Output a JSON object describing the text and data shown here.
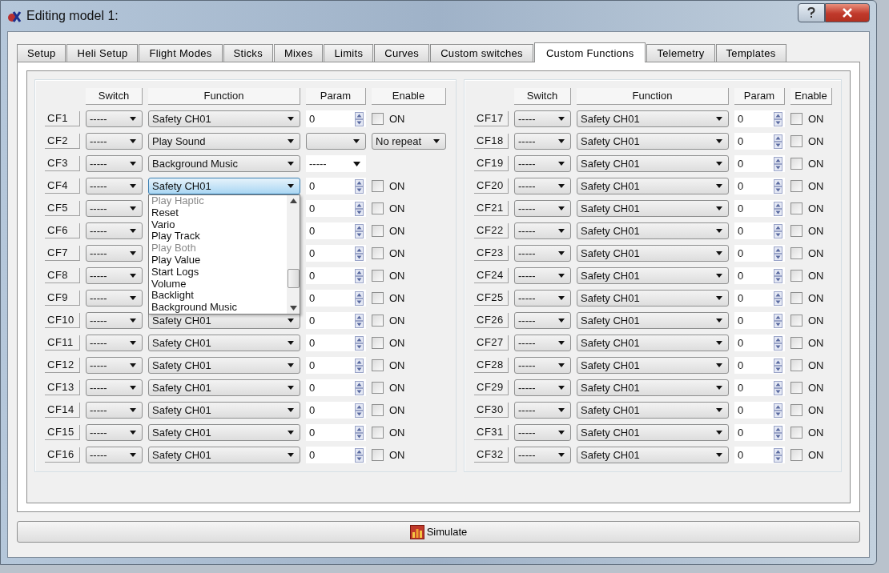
{
  "window": {
    "title": "Editing model 1:"
  },
  "tabs": [
    {
      "label": "Setup",
      "selected": false
    },
    {
      "label": "Heli Setup",
      "selected": false
    },
    {
      "label": "Flight Modes",
      "selected": false
    },
    {
      "label": "Sticks",
      "selected": false
    },
    {
      "label": "Mixes",
      "selected": false
    },
    {
      "label": "Limits",
      "selected": false
    },
    {
      "label": "Curves",
      "selected": false
    },
    {
      "label": "Custom switches",
      "selected": false
    },
    {
      "label": "Custom Functions",
      "selected": true
    },
    {
      "label": "Telemetry",
      "selected": false
    },
    {
      "label": "Templates",
      "selected": false
    }
  ],
  "groups": [
    {
      "headers": [
        "Switch",
        "Function",
        "Param",
        "Enable"
      ],
      "rows": [
        {
          "label": "CF1",
          "switch": "-----",
          "function": {
            "value": "Safety CH01",
            "focused": false
          },
          "param": {
            "kind": "spin",
            "value": "0"
          },
          "enable": {
            "kind": "checkbox",
            "checked": false,
            "label": "ON"
          }
        },
        {
          "label": "CF2",
          "switch": "-----",
          "function": {
            "value": "Play Sound",
            "focused": false
          },
          "param": {
            "kind": "select"
          },
          "enable": {
            "kind": "select",
            "value": "No repeat"
          }
        },
        {
          "label": "CF3",
          "switch": "-----",
          "function": {
            "value": "Background Music",
            "focused": false
          },
          "param": {
            "kind": "plain-select",
            "value": "-----"
          }
        },
        {
          "label": "CF4",
          "switch": "-----",
          "function": {
            "value": "Safety CH01",
            "focused": true,
            "options": [
              {
                "label": "Play Haptic",
                "disabled": true
              },
              {
                "label": "Reset",
                "disabled": false
              },
              {
                "label": "Vario",
                "disabled": false
              },
              {
                "label": "Play Track",
                "disabled": false
              },
              {
                "label": "Play Both",
                "disabled": true
              },
              {
                "label": "Play Value",
                "disabled": false
              },
              {
                "label": "Start Logs",
                "disabled": false
              },
              {
                "label": "Volume",
                "disabled": false
              },
              {
                "label": "Backlight",
                "disabled": false
              },
              {
                "label": "Background Music",
                "disabled": false
              }
            ]
          },
          "param": {
            "kind": "spin",
            "value": "0"
          },
          "enable": {
            "kind": "checkbox",
            "checked": false,
            "label": "ON"
          }
        },
        {
          "label": "CF5",
          "switch": "-----",
          "param": {
            "kind": "spin",
            "value": "0"
          },
          "enable": {
            "kind": "checkbox",
            "checked": false,
            "label": "ON"
          }
        },
        {
          "label": "CF6",
          "switch": "-----",
          "param": {
            "kind": "spin",
            "value": "0"
          },
          "enable": {
            "kind": "checkbox",
            "checked": false,
            "label": "ON"
          }
        },
        {
          "label": "CF7",
          "switch": "-----",
          "param": {
            "kind": "spin",
            "value": "0"
          },
          "enable": {
            "kind": "checkbox",
            "checked": false,
            "label": "ON"
          }
        },
        {
          "label": "CF8",
          "switch": "-----",
          "param": {
            "kind": "spin",
            "value": "0"
          },
          "enable": {
            "kind": "checkbox",
            "checked": false,
            "label": "ON"
          }
        },
        {
          "label": "CF9",
          "switch": "-----",
          "param": {
            "kind": "spin",
            "value": "0"
          },
          "enable": {
            "kind": "checkbox",
            "checked": false,
            "label": "ON"
          }
        },
        {
          "label": "CF10",
          "switch": "-----",
          "function": {
            "value": "Safety CH01",
            "focused": false
          },
          "param": {
            "kind": "spin",
            "value": "0"
          },
          "enable": {
            "kind": "checkbox",
            "checked": false,
            "label": "ON"
          }
        },
        {
          "label": "CF11",
          "switch": "-----",
          "function": {
            "value": "Safety CH01",
            "focused": false
          },
          "param": {
            "kind": "spin",
            "value": "0"
          },
          "enable": {
            "kind": "checkbox",
            "checked": false,
            "label": "ON"
          }
        },
        {
          "label": "CF12",
          "switch": "-----",
          "function": {
            "value": "Safety CH01",
            "focused": false
          },
          "param": {
            "kind": "spin",
            "value": "0"
          },
          "enable": {
            "kind": "checkbox",
            "checked": false,
            "label": "ON"
          }
        },
        {
          "label": "CF13",
          "switch": "-----",
          "function": {
            "value": "Safety CH01",
            "focused": false
          },
          "param": {
            "kind": "spin",
            "value": "0"
          },
          "enable": {
            "kind": "checkbox",
            "checked": false,
            "label": "ON"
          }
        },
        {
          "label": "CF14",
          "switch": "-----",
          "function": {
            "value": "Safety CH01",
            "focused": false
          },
          "param": {
            "kind": "spin",
            "value": "0"
          },
          "enable": {
            "kind": "checkbox",
            "checked": false,
            "label": "ON"
          }
        },
        {
          "label": "CF15",
          "switch": "-----",
          "function": {
            "value": "Safety CH01",
            "focused": false
          },
          "param": {
            "kind": "spin",
            "value": "0"
          },
          "enable": {
            "kind": "checkbox",
            "checked": false,
            "label": "ON"
          }
        },
        {
          "label": "CF16",
          "switch": "-----",
          "function": {
            "value": "Safety CH01",
            "focused": false
          },
          "param": {
            "kind": "spin",
            "value": "0"
          },
          "enable": {
            "kind": "checkbox",
            "checked": false,
            "label": "ON"
          }
        }
      ]
    },
    {
      "headers": [
        "Switch",
        "Function",
        "Param",
        "Enable"
      ],
      "rows": [
        {
          "label": "CF17",
          "switch": "-----",
          "function": {
            "value": "Safety CH01",
            "focused": false
          },
          "param": {
            "kind": "spin",
            "value": "0"
          },
          "enable": {
            "kind": "checkbox",
            "checked": false,
            "label": "ON"
          }
        },
        {
          "label": "CF18",
          "switch": "-----",
          "function": {
            "value": "Safety CH01",
            "focused": false
          },
          "param": {
            "kind": "spin",
            "value": "0"
          },
          "enable": {
            "kind": "checkbox",
            "checked": false,
            "label": "ON"
          }
        },
        {
          "label": "CF19",
          "switch": "-----",
          "function": {
            "value": "Safety CH01",
            "focused": false
          },
          "param": {
            "kind": "spin",
            "value": "0"
          },
          "enable": {
            "kind": "checkbox",
            "checked": false,
            "label": "ON"
          }
        },
        {
          "label": "CF20",
          "switch": "-----",
          "function": {
            "value": "Safety CH01",
            "focused": false
          },
          "param": {
            "kind": "spin",
            "value": "0"
          },
          "enable": {
            "kind": "checkbox",
            "checked": false,
            "label": "ON"
          }
        },
        {
          "label": "CF21",
          "switch": "-----",
          "function": {
            "value": "Safety CH01",
            "focused": false
          },
          "param": {
            "kind": "spin",
            "value": "0"
          },
          "enable": {
            "kind": "checkbox",
            "checked": false,
            "label": "ON"
          }
        },
        {
          "label": "CF22",
          "switch": "-----",
          "function": {
            "value": "Safety CH01",
            "focused": false
          },
          "param": {
            "kind": "spin",
            "value": "0"
          },
          "enable": {
            "kind": "checkbox",
            "checked": false,
            "label": "ON"
          }
        },
        {
          "label": "CF23",
          "switch": "-----",
          "function": {
            "value": "Safety CH01",
            "focused": false
          },
          "param": {
            "kind": "spin",
            "value": "0"
          },
          "enable": {
            "kind": "checkbox",
            "checked": false,
            "label": "ON"
          }
        },
        {
          "label": "CF24",
          "switch": "-----",
          "function": {
            "value": "Safety CH01",
            "focused": false
          },
          "param": {
            "kind": "spin",
            "value": "0"
          },
          "enable": {
            "kind": "checkbox",
            "checked": false,
            "label": "ON"
          }
        },
        {
          "label": "CF25",
          "switch": "-----",
          "function": {
            "value": "Safety CH01",
            "focused": false
          },
          "param": {
            "kind": "spin",
            "value": "0"
          },
          "enable": {
            "kind": "checkbox",
            "checked": false,
            "label": "ON"
          }
        },
        {
          "label": "CF26",
          "switch": "-----",
          "function": {
            "value": "Safety CH01",
            "focused": false
          },
          "param": {
            "kind": "spin",
            "value": "0"
          },
          "enable": {
            "kind": "checkbox",
            "checked": false,
            "label": "ON"
          }
        },
        {
          "label": "CF27",
          "switch": "-----",
          "function": {
            "value": "Safety CH01",
            "focused": false
          },
          "param": {
            "kind": "spin",
            "value": "0"
          },
          "enable": {
            "kind": "checkbox",
            "checked": false,
            "label": "ON"
          }
        },
        {
          "label": "CF28",
          "switch": "-----",
          "function": {
            "value": "Safety CH01",
            "focused": false
          },
          "param": {
            "kind": "spin",
            "value": "0"
          },
          "enable": {
            "kind": "checkbox",
            "checked": false,
            "label": "ON"
          }
        },
        {
          "label": "CF29",
          "switch": "-----",
          "function": {
            "value": "Safety CH01",
            "focused": false
          },
          "param": {
            "kind": "spin",
            "value": "0"
          },
          "enable": {
            "kind": "checkbox",
            "checked": false,
            "label": "ON"
          }
        },
        {
          "label": "CF30",
          "switch": "-----",
          "function": {
            "value": "Safety CH01",
            "focused": false
          },
          "param": {
            "kind": "spin",
            "value": "0"
          },
          "enable": {
            "kind": "checkbox",
            "checked": false,
            "label": "ON"
          }
        },
        {
          "label": "CF31",
          "switch": "-----",
          "function": {
            "value": "Safety CH01",
            "focused": false
          },
          "param": {
            "kind": "spin",
            "value": "0"
          },
          "enable": {
            "kind": "checkbox",
            "checked": false,
            "label": "ON"
          }
        },
        {
          "label": "CF32",
          "switch": "-----",
          "function": {
            "value": "Safety CH01",
            "focused": false
          },
          "param": {
            "kind": "spin",
            "value": "0"
          },
          "enable": {
            "kind": "checkbox",
            "checked": false,
            "label": "ON"
          }
        }
      ]
    }
  ],
  "simulate_button": {
    "label": "Simulate"
  }
}
